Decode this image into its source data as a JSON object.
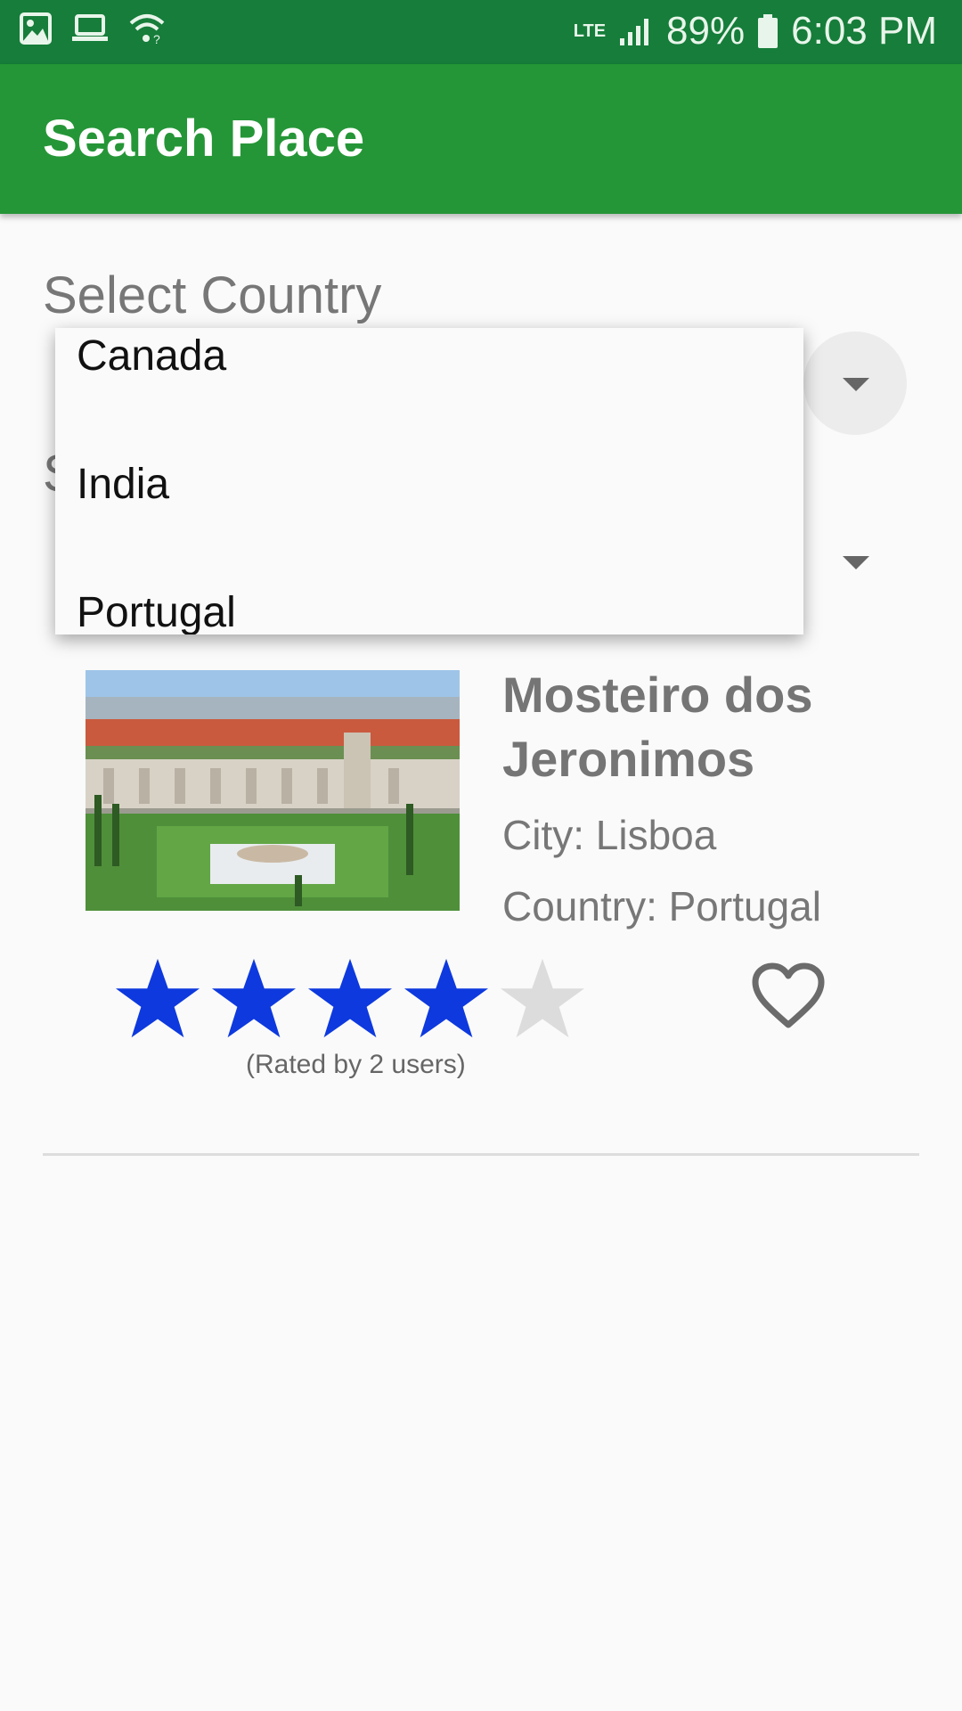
{
  "status_bar": {
    "icons_left": [
      "image-icon",
      "laptop-icon",
      "wifi-icon"
    ],
    "network": "LTE",
    "battery": "89%",
    "time": "6:03 PM"
  },
  "app_bar": {
    "title": "Search Place",
    "color": "#259637"
  },
  "form": {
    "country_label": "Select Country",
    "city_label_partial": "S"
  },
  "country_dropdown": {
    "options": [
      "Canada",
      "India",
      "Portugal"
    ]
  },
  "place": {
    "name": "Mosteiro dos Jeronimos",
    "city": "City: Lisboa",
    "country": "Country: Portugal",
    "rating": 4,
    "max_rating": 5,
    "rated_by": "(Rated by 2 users)",
    "star_color": "#0d39de",
    "favorite": false
  }
}
